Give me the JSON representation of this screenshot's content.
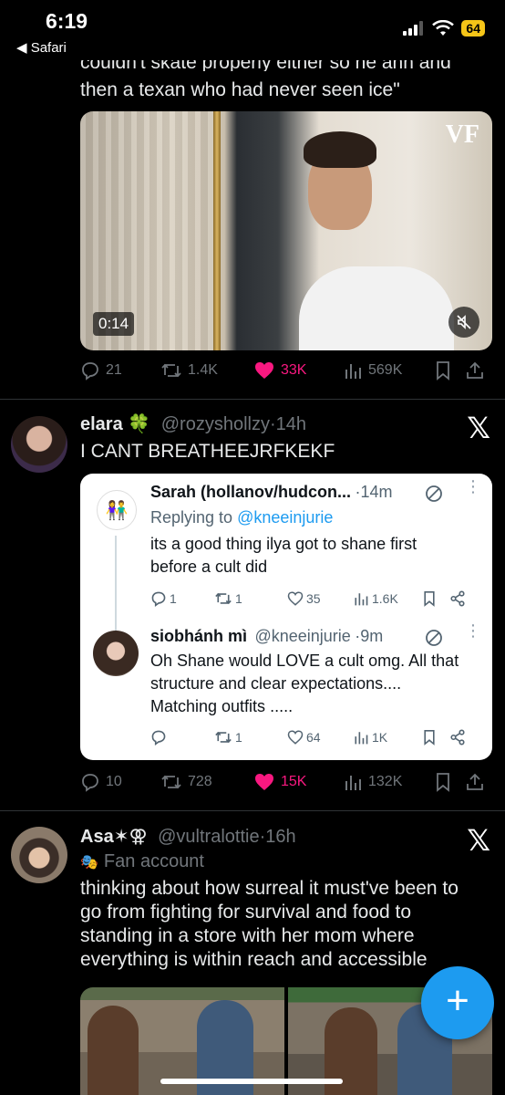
{
  "status_bar": {
    "time": "6:19",
    "back_app": "◀ Safari",
    "battery": "64"
  },
  "tweet1": {
    "text_cutoff": "couldn't skate properly either so he ann and",
    "text_line2": "then a texan who had never seen ice\"",
    "video": {
      "duration": "0:14",
      "watermark": "VF"
    },
    "stats": {
      "replies": "21",
      "reposts": "1.4K",
      "likes": "33K",
      "views": "569K"
    }
  },
  "tweet2": {
    "name": "elara 🍀",
    "handle": "@rozyshollzy",
    "time": "14h",
    "text": "I CANT BREATHEEJRFKEKF",
    "quote": {
      "reply1": {
        "name": "Sarah (hollanov/hudcon...",
        "time": "14m",
        "replying_prefix": "Replying to",
        "replying_handle": "@kneeinjurie",
        "text_line1": "its a good thing ilya got to shane first",
        "text_line2": "before a cult did",
        "stats": {
          "replies": "1",
          "reposts": "1",
          "likes": "35",
          "views": "1.6K"
        }
      },
      "reply2": {
        "name": "siobhánh mì",
        "handle": "@kneeinjurie",
        "time": "9m",
        "text_line1": "Oh Shane would LOVE a cult omg. All that",
        "text_line2": "structure and clear expectations....",
        "text_line3": "Matching outfits .....",
        "stats": {
          "reposts": "1",
          "likes": "64",
          "views": "1K"
        }
      }
    },
    "stats": {
      "replies": "10",
      "reposts": "728",
      "likes": "15K",
      "views": "132K"
    }
  },
  "tweet3": {
    "name": "Asa✶⚢",
    "handle": "@vultralottie",
    "time": "16h",
    "label": "Fan account",
    "text_line1": "thinking about how surreal it must've been to",
    "text_line2": "go from fighting for survival and food to",
    "text_line3": "standing in a store with her mom where",
    "text_line4": "everything is within reach and accessible"
  },
  "colors": {
    "like_pink": "#f91880",
    "accent_blue": "#1d9bf0",
    "muted_gray": "#71767b"
  }
}
